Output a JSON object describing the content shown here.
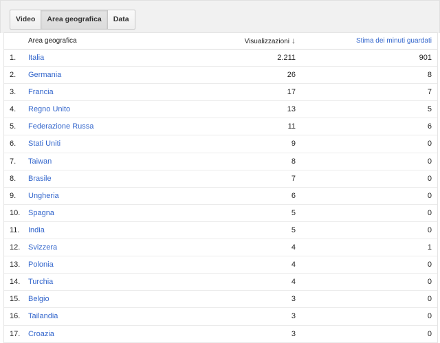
{
  "tabs": [
    "Video",
    "Area geografica",
    "Data"
  ],
  "columns": {
    "area": "Area geografica",
    "views": "Visualizzazioni",
    "minutes": "Stima dei minuti guardati"
  },
  "rows": [
    {
      "rank": "1.",
      "area": "Italia",
      "views": "2.211",
      "minutes": "901"
    },
    {
      "rank": "2.",
      "area": "Germania",
      "views": "26",
      "minutes": "8"
    },
    {
      "rank": "3.",
      "area": "Francia",
      "views": "17",
      "minutes": "7"
    },
    {
      "rank": "4.",
      "area": "Regno Unito",
      "views": "13",
      "minutes": "5"
    },
    {
      "rank": "5.",
      "area": "Federazione Russa",
      "views": "11",
      "minutes": "6"
    },
    {
      "rank": "6.",
      "area": "Stati Uniti",
      "views": "9",
      "minutes": "0"
    },
    {
      "rank": "7.",
      "area": "Taiwan",
      "views": "8",
      "minutes": "0"
    },
    {
      "rank": "8.",
      "area": "Brasile",
      "views": "7",
      "minutes": "0"
    },
    {
      "rank": "9.",
      "area": "Ungheria",
      "views": "6",
      "minutes": "0"
    },
    {
      "rank": "10.",
      "area": "Spagna",
      "views": "5",
      "minutes": "0"
    },
    {
      "rank": "11.",
      "area": "India",
      "views": "5",
      "minutes": "0"
    },
    {
      "rank": "12.",
      "area": "Svizzera",
      "views": "4",
      "minutes": "1"
    },
    {
      "rank": "13.",
      "area": "Polonia",
      "views": "4",
      "minutes": "0"
    },
    {
      "rank": "14.",
      "area": "Turchia",
      "views": "4",
      "minutes": "0"
    },
    {
      "rank": "15.",
      "area": "Belgio",
      "views": "3",
      "minutes": "0"
    },
    {
      "rank": "16.",
      "area": "Tailandia",
      "views": "3",
      "minutes": "0"
    },
    {
      "rank": "17.",
      "area": "Croazia",
      "views": "3",
      "minutes": "0"
    }
  ],
  "colors": {
    "link": "#3366cc",
    "active_tab": "#dcdcdc",
    "toolbar": "#f1f1f1"
  },
  "icons": {
    "sort": "arrow-down-icon"
  }
}
